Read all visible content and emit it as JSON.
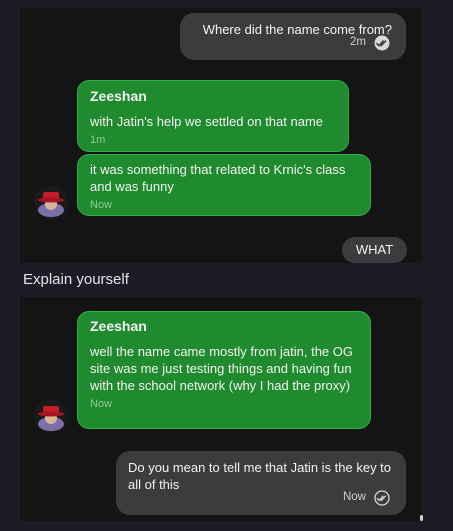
{
  "messages": [
    {
      "text": "Where did the name come from?",
      "time": "2m"
    },
    {
      "sender": "Zeeshan",
      "text": "with Jatin's help we settled on that name",
      "time": "1m"
    },
    {
      "text": "it was something that related to Krnic's class and was funny",
      "time": "Now"
    },
    {
      "text": "WHAT"
    },
    {
      "sender": "Zeeshan",
      "text": "well the name came mostly from jatin, the OG site was me just testing things and having fun with the school network (why I had the proxy)",
      "time": "Now"
    },
    {
      "text": "Do you mean to tell me that Jatin is the key to all of this",
      "time": "Now"
    }
  ],
  "caption": "Explain yourself",
  "colors": {
    "page_bg": "#1d1b26",
    "panel_bg": "#141414",
    "received_bubble": "#1f8a2e",
    "sent_bubble": "#3c3c3e"
  },
  "icons": {
    "read_receipt": "double-check-icon",
    "avatar": "red-hat-avatar"
  }
}
